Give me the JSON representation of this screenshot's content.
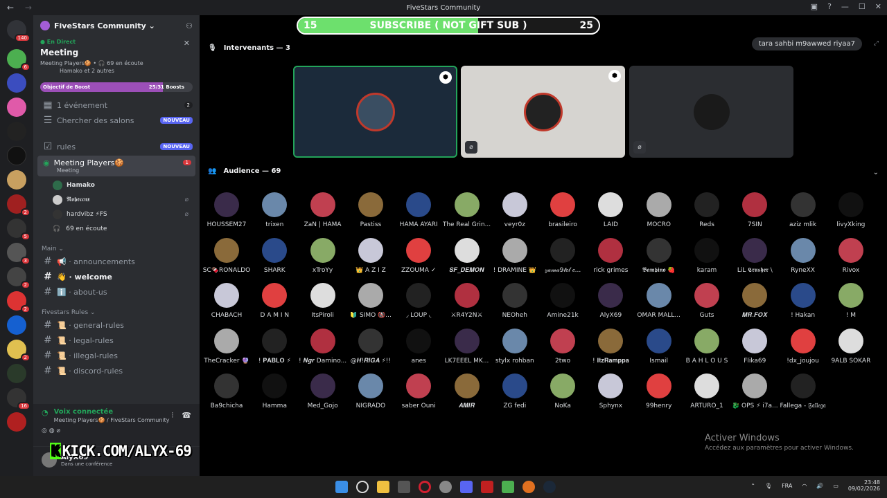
{
  "window": {
    "title": "FiveStars Community",
    "back": "←",
    "forward": "→"
  },
  "server": {
    "name": "FiveStars Community ⌄"
  },
  "live": {
    "tag": "En Direct",
    "title": "Meeting",
    "stats": "Meeting Players🍪 • 🎧 69 en écoute",
    "speakers": "Hamako et 2 autres"
  },
  "boost": {
    "label": "Objectif de Boost",
    "progress": "25/31 Boosts",
    "fraction": 0.806
  },
  "channels": {
    "events": "1 événement",
    "events_count": "2",
    "search": "Chercher des salons",
    "new_badge": "NOUVEAU",
    "rules": "rules",
    "stage": "Meeting Players🍪",
    "stage_sub": "Meeting",
    "stage_count": "1",
    "voice_users": [
      "Hamako",
      "𝕽𝖔𝖇𝖊𝖈𝖈𝖓𝖝",
      "hardvibz ⚡FS"
    ],
    "listeners": "69 en écoute",
    "cat_main": "Main ⌄",
    "main": [
      "📢 · announcements",
      "👋 · welcome",
      "ℹ️ · about-us"
    ],
    "cat_rules": "Fivestars Rules ⌄",
    "rules_list": [
      "📜 · general-rules",
      "📜 · legal-rules",
      "📜 · illegal-rules",
      "📜 · discord-rules"
    ]
  },
  "voice": {
    "status": "Voix connectée",
    "sub": "Meeting Players🍪 / FiveStars Community"
  },
  "user": {
    "name": "AlyX69",
    "status": "Dans une conférence"
  },
  "kick": {
    "k": "K",
    "url": "KICK.COM/ALYX-69"
  },
  "subbar": {
    "left": "15",
    "text": "SUBSCRIBE ( NOT GIFT SUB )",
    "right": "25",
    "fill": 0.6
  },
  "stage": {
    "speakers_label": "Intervenants — 3",
    "topic": "tara sahbi m9awwed riyaa7",
    "audience_label": "Audience — 69"
  },
  "audience": [
    "HOUSSEM27",
    "trixen",
    "ZaN | HAMA",
    "Pastiss",
    "HAMA AYARI",
    "The Real Grin...",
    "veyr0z",
    "brasileiro",
    "LAID",
    "MOCRO",
    "Reds",
    "7SIN",
    "aziz mlik",
    "livyXking",
    "SC🍫RONALDO",
    "SHARK",
    "xTroYy",
    "👑 A Z I Z",
    "ZZOUMA ✓",
    "𝑺𝑭_𝑫𝑬𝑴𝑶𝑵",
    "! DRAMINE 👑",
    "𝓏𝒶𝓂𝒶9𝓉𝑒𝓁 𝑒...",
    "rick grimes",
    "𝕭𝖆𝖒𝖇𝖎𝖓𝖔 🍓",
    "karam",
    "LiL 𝕮𝖗𝖚𝖘𝖍𝖊𝖗 \\",
    "RyneXX",
    "Rivox",
    "CHABACH",
    "D A M I N",
    "ItsPiroli",
    "🔰 SIMO 🚷...",
    "◞ LOUP ◟",
    "⚔R4Y2N⚔",
    "NEOheh",
    "Amine21k",
    "AlyX69",
    "OMAR MALL...",
    "Guts",
    "𝑴𝑹.𝑭𝑶𝑿",
    "! Hakan",
    "! M",
    "TheCracker 🔮",
    "! 𝐏𝐀𝐁𝐋𝐎 ⚡",
    "! 𝑵𝒈𝒓 Damino...",
    "@𝑯!𝑹𝑰𝑮𝑨 ⚡!!",
    "anes",
    "LK7EEEL MK...",
    "stylx rohban",
    "2two",
    "! 𝐈𝐭𝐳𝐑𝐚𝐦𝐩𝐩𝐚",
    "Ismail",
    "B A H L O U S",
    "Flika69",
    "!dx_joujou",
    "9ALB SOKAR",
    "Ba9chicha",
    "Hamma",
    "Med_Gojo",
    "NIGRADO",
    "saber Ouni",
    "𝑨𝑴𝑰𝑹",
    "ZG fedi",
    "NoKa",
    "Sphynx",
    "99henry",
    "ARTURO_1",
    "🐉 OPS ⚡ i7a...",
    "Fallega - 𝔉𝔞𝔩𝔩𝔢𝔤𝔞"
  ],
  "watermark": {
    "title": "Activer Windows",
    "sub": "Accédez aux paramètres pour activer Windows."
  },
  "taskbar": {
    "lang": "FRA",
    "time": "23:48",
    "date": "09/02/2026"
  },
  "colors": {
    "accent": "#5865f2",
    "online": "#23a55a",
    "danger": "#da373c",
    "kick": "#53fc18"
  }
}
